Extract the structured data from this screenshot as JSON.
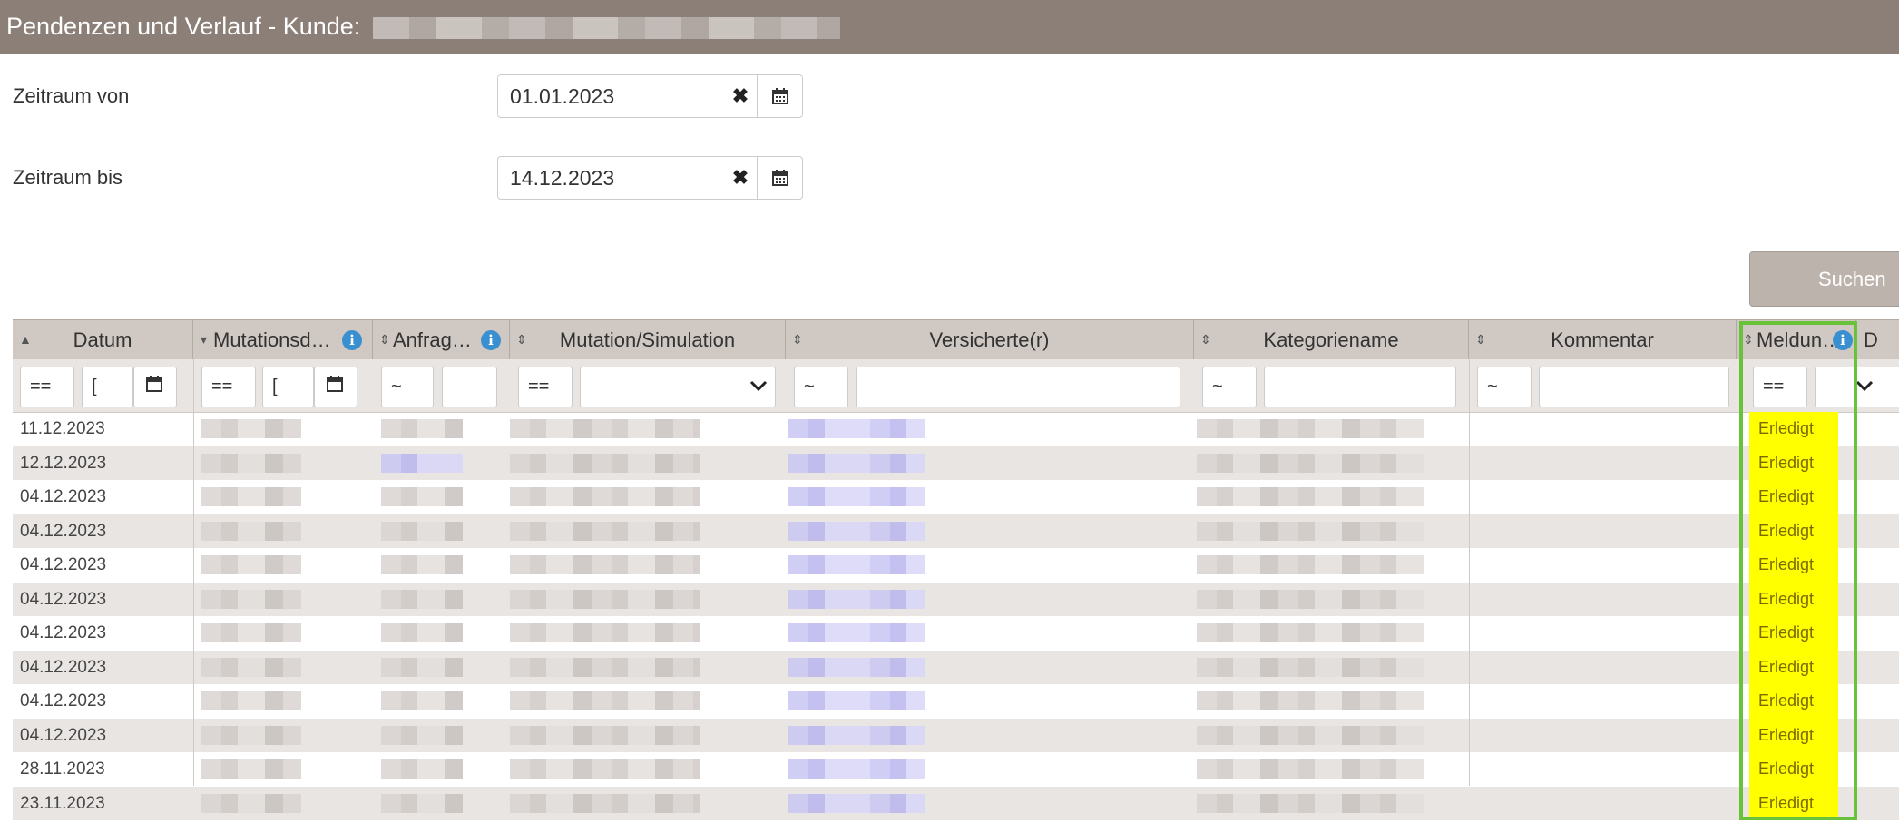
{
  "window": {
    "title": "Pendenzen und Verlauf - Kunde:"
  },
  "form": {
    "from_label": "Zeitraum von",
    "from_value": "01.01.2023",
    "to_label": "Zeitraum bis",
    "to_value": "14.12.2023",
    "search_label": "Suchen"
  },
  "table": {
    "columns": [
      {
        "label": "Datum"
      },
      {
        "label": "Mutationsd…"
      },
      {
        "label": "Anfrag…"
      },
      {
        "label": "Mutation/Simulation"
      },
      {
        "label": "Versicherte(r)"
      },
      {
        "label": "Kategoriename"
      },
      {
        "label": "Kommentar"
      },
      {
        "label": "Meldun…"
      },
      {
        "label": "D"
      }
    ],
    "filters": {
      "datum_op": "==",
      "mut_op": "==",
      "anfrag_op": "~",
      "mutsim_op": "==",
      "vers_op": "~",
      "kat_op": "~",
      "komm_op": "~",
      "meld_op": "=="
    },
    "rows": [
      {
        "datum": "11.12.2023",
        "status": "Erledigt"
      },
      {
        "datum": "12.12.2023",
        "status": "Erledigt"
      },
      {
        "datum": "04.12.2023",
        "status": "Erledigt"
      },
      {
        "datum": "04.12.2023",
        "status": "Erledigt"
      },
      {
        "datum": "04.12.2023",
        "status": "Erledigt"
      },
      {
        "datum": "04.12.2023",
        "status": "Erledigt"
      },
      {
        "datum": "04.12.2023",
        "status": "Erledigt"
      },
      {
        "datum": "04.12.2023",
        "status": "Erledigt"
      },
      {
        "datum": "04.12.2023",
        "status": "Erledigt"
      },
      {
        "datum": "04.12.2023",
        "status": "Erledigt"
      },
      {
        "datum": "28.11.2023",
        "status": "Erledigt"
      },
      {
        "datum": "23.11.2023",
        "status": "Erledigt"
      }
    ]
  },
  "colors": {
    "header": "#8b7f78",
    "status_bg": "#ffff00",
    "highlight": "#6ac13a",
    "info": "#3a8fd0"
  },
  "icons": [
    "sort-icon",
    "info-icon",
    "calendar-icon",
    "clear-icon",
    "chevron-down-icon"
  ]
}
